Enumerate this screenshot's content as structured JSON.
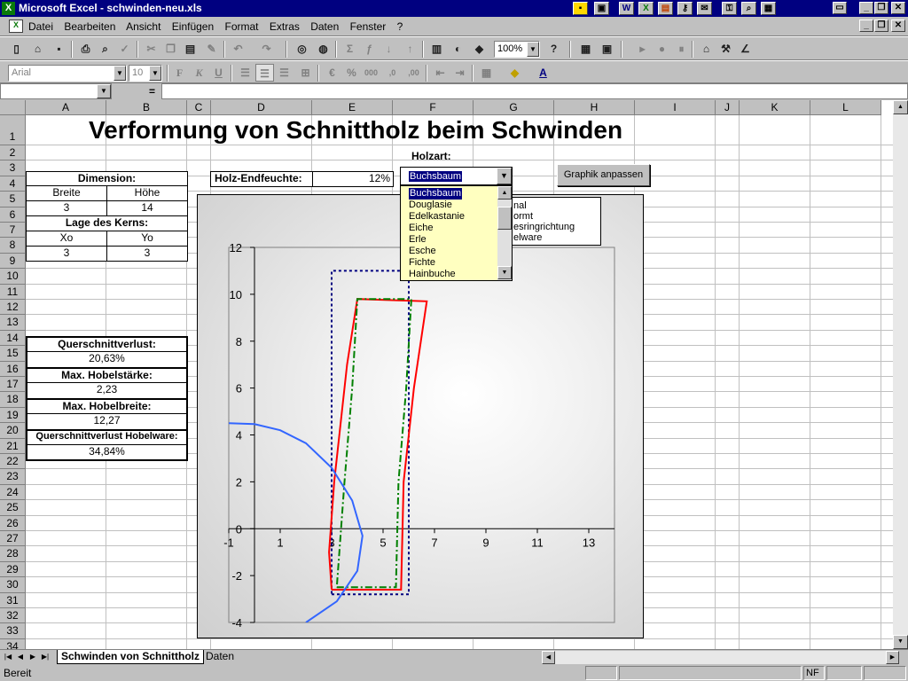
{
  "window": {
    "app_icon": "excel-icon",
    "title": "Microsoft Excel - schwinden-neu.xls",
    "tray_icons": [
      "ms-office-icon",
      "word-icon",
      "excel-icon",
      "powerpoint-icon",
      "access-icon",
      "clippy-icon",
      "outlook-icon",
      "binder-icon"
    ]
  },
  "menu": [
    "Datei",
    "Bearbeiten",
    "Ansicht",
    "Einfügen",
    "Format",
    "Extras",
    "Daten",
    "Fenster",
    "?"
  ],
  "toolbar": {
    "zoom": "100%",
    "font_name": "Arial",
    "font_size": "10"
  },
  "formula_bar": {
    "name_box": "",
    "eq": "=",
    "content": ""
  },
  "columns": [
    "A",
    "B",
    "C",
    "D",
    "E",
    "F",
    "G",
    "H",
    "I",
    "J",
    "K",
    "L"
  ],
  "rows": [
    "1",
    "2",
    "3",
    "4",
    "5",
    "6",
    "7",
    "8",
    "9",
    "10",
    "11",
    "12",
    "13",
    "14",
    "15",
    "16",
    "17",
    "18",
    "19",
    "20",
    "21",
    "22",
    "23",
    "24",
    "25",
    "26",
    "27",
    "28",
    "29",
    "30",
    "31",
    "32",
    "33",
    "34"
  ],
  "sheet": {
    "title": "Verformung von Schnittholz beim Schwinden",
    "dimension_label": "Dimension:",
    "breite_label": "Breite",
    "hoehe_label": "Höhe",
    "breite": "3",
    "hoehe": "14",
    "kern_label": "Lage des Kerns:",
    "xo_label": "Xo",
    "yo_label": "Yo",
    "xo": "3",
    "yo": "3",
    "qv_label": "Querschnittverlust:",
    "qv": "20,63%",
    "mhs_label": "Max. Hobelstärke:",
    "mhs": "2,23",
    "mhb_label": "Max. Hobelbreite:",
    "mhb": "12,27",
    "qvh_label": "Querschnittverlust Hobelware:",
    "qvh": "34,84%",
    "endfeuchte_label": "Holz-Endfeuchte:",
    "endfeuchte": "12%",
    "holzart_label": "Holzart:",
    "holzart_selected": "Buchsbaum",
    "holzart_options": [
      "Buchsbaum",
      "Douglasie",
      "Edelkastanie",
      "Eiche",
      "Erle",
      "Esche",
      "Fichte",
      "Hainbuche"
    ],
    "graphik_button": "Graphik anpassen"
  },
  "legend_items": [
    "nal",
    "ormt",
    "esringrichtung",
    "elware"
  ],
  "chart_data": {
    "type": "scatter",
    "xlim": [
      -1,
      14
    ],
    "ylim": [
      -4,
      12
    ],
    "xticks": [
      "-1",
      "1",
      "3",
      "5",
      "7",
      "9",
      "11",
      "13"
    ],
    "yticks": [
      "-4",
      "-2",
      "0",
      "2",
      "4",
      "6",
      "8",
      "10",
      "12"
    ],
    "grid": false,
    "series": [
      {
        "color": "#000080",
        "dash": "dotted",
        "points": [
          [
            3,
            -2.8
          ],
          [
            6,
            -2.8
          ],
          [
            6,
            11
          ],
          [
            3,
            11
          ],
          [
            3,
            -2.8
          ]
        ]
      },
      {
        "color": "#ff0000",
        "dash": "solid",
        "points": [
          [
            3,
            -2.6
          ],
          [
            5.7,
            -2.6
          ],
          [
            5.8,
            2
          ],
          [
            6.2,
            6
          ],
          [
            6.7,
            9.7
          ],
          [
            4,
            9.8
          ],
          [
            3.6,
            7
          ],
          [
            3.1,
            2
          ],
          [
            2.9,
            -1
          ],
          [
            3,
            -2.6
          ]
        ]
      },
      {
        "color": "#008000",
        "dash": "dashdot",
        "points": [
          [
            3.2,
            -2.5
          ],
          [
            5.5,
            -2.5
          ],
          [
            5.6,
            2
          ],
          [
            5.9,
            6
          ],
          [
            6.1,
            9.8
          ],
          [
            4,
            9.8
          ],
          [
            3.8,
            6
          ],
          [
            3.5,
            2
          ],
          [
            3.2,
            -2.5
          ]
        ]
      },
      {
        "color": "#3366ff",
        "dash": "solid",
        "points": [
          [
            -1,
            4.5
          ],
          [
            0,
            4.46
          ],
          [
            1,
            4.2
          ],
          [
            2,
            3.65
          ],
          [
            3,
            2.6
          ],
          [
            3.8,
            1.2
          ],
          [
            4.2,
            -0.3
          ],
          [
            4,
            -1.8
          ],
          [
            3.2,
            -3.1
          ],
          [
            2,
            -4
          ]
        ]
      }
    ]
  },
  "sheet_tabs": [
    "Schwinden von Schnittholz",
    "Daten"
  ],
  "status": {
    "text": "Bereit",
    "num": "NF"
  }
}
